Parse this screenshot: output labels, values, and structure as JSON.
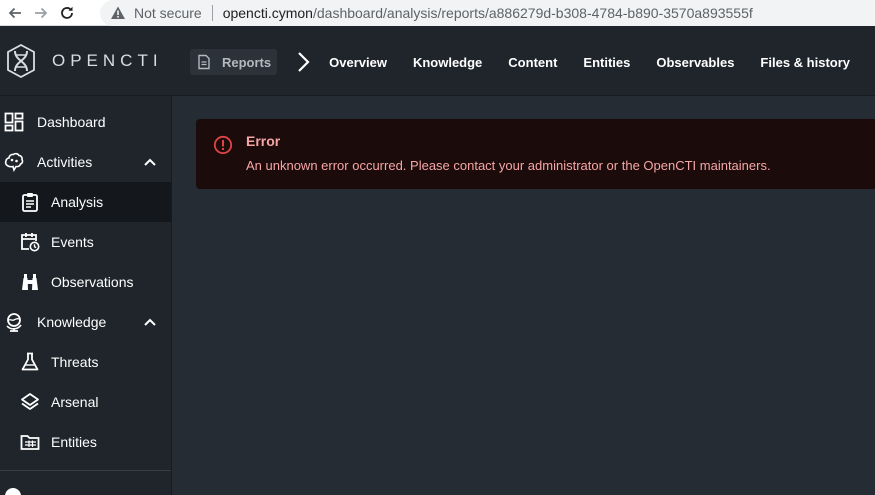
{
  "browser": {
    "security_label": "Not secure",
    "url_host": "opencti.cymon",
    "url_path": "/dashboard/analysis/reports/a886279d-b308-4784-b890-3570a893555f"
  },
  "app": {
    "logo_text": "OPENCTI"
  },
  "top_nav": {
    "breadcrumb": "Reports",
    "tabs": [
      "Overview",
      "Knowledge",
      "Content",
      "Entities",
      "Observables",
      "Files & history"
    ]
  },
  "sidebar": {
    "items": [
      {
        "label": "Dashboard",
        "icon": "dashboard-icon"
      },
      {
        "label": "Activities",
        "icon": "brain-icon"
      },
      {
        "label": "Analysis",
        "icon": "clipboard-icon"
      },
      {
        "label": "Events",
        "icon": "calendar-clock-icon"
      },
      {
        "label": "Observations",
        "icon": "binoculars-icon"
      },
      {
        "label": "Knowledge",
        "icon": "globe-icon"
      },
      {
        "label": "Threats",
        "icon": "flask-icon"
      },
      {
        "label": "Arsenal",
        "icon": "layers-icon"
      },
      {
        "label": "Entities",
        "icon": "folder-table-icon"
      }
    ]
  },
  "error": {
    "title": "Error",
    "message": "An unknown error occurred. Please contact your administrator or the OpenCTI maintainers."
  },
  "colors": {
    "app_bg": "#252c33",
    "sidebar_bg": "#1f252b",
    "error_bg": "#1c0b0b",
    "error_text": "#f6a5a5",
    "error_icon": "#e04444"
  }
}
